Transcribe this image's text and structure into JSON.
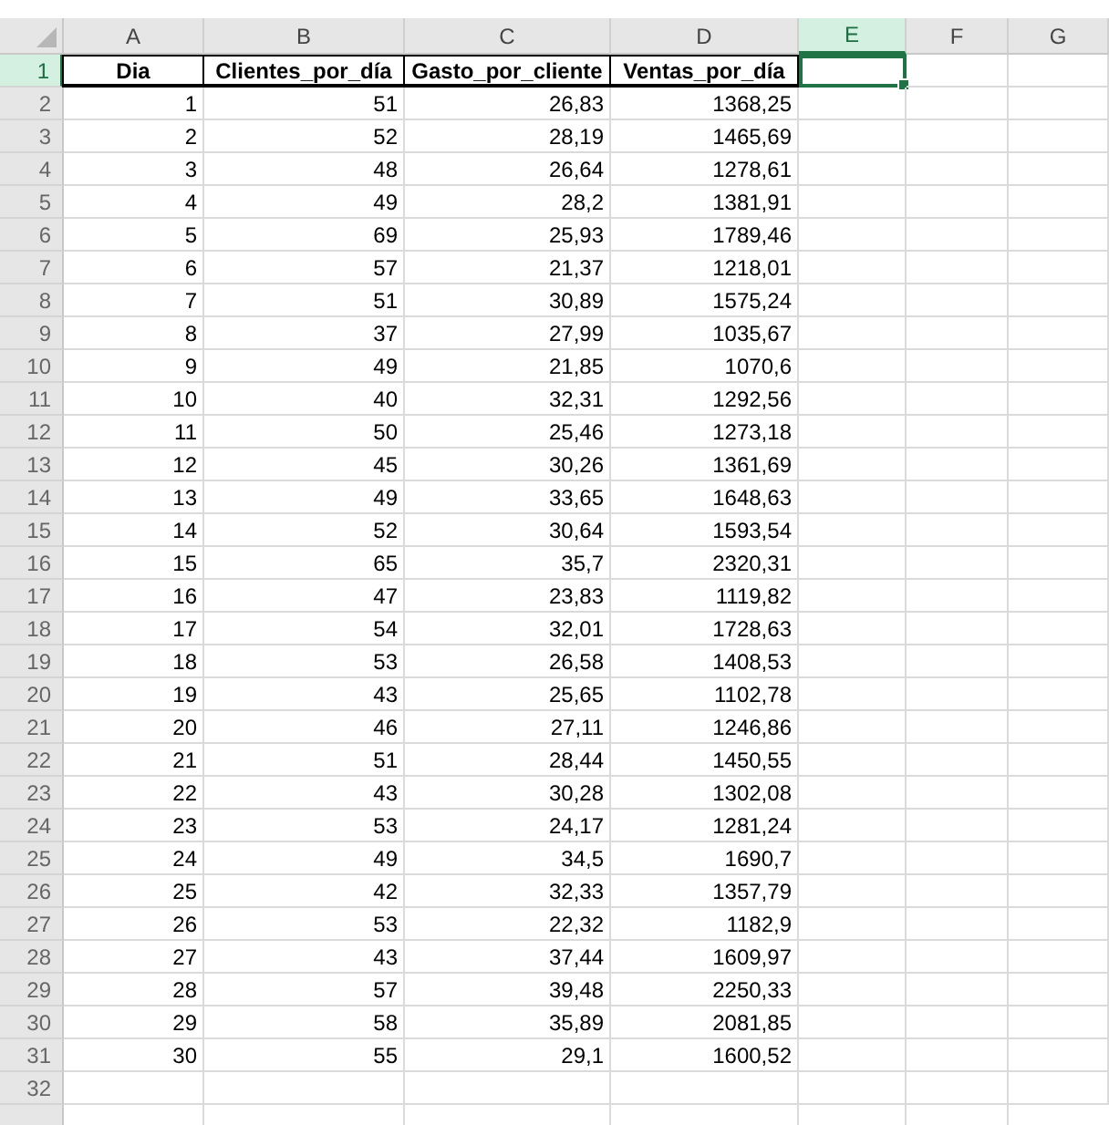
{
  "column_headers": [
    {
      "label": "A",
      "selected": false
    },
    {
      "label": "B",
      "selected": false
    },
    {
      "label": "C",
      "selected": false
    },
    {
      "label": "D",
      "selected": false
    },
    {
      "label": "E",
      "selected": true
    },
    {
      "label": "F",
      "selected": false
    },
    {
      "label": "G",
      "selected": false
    }
  ],
  "rows": [
    {
      "label": "1",
      "selected": true,
      "kind": "header",
      "cells": [
        "Dia",
        "Clientes_por_día",
        "Gasto_por_cliente",
        "Ventas_por_día"
      ]
    },
    {
      "label": "2",
      "selected": false,
      "kind": "data",
      "cells": [
        "1",
        "51",
        "26,83",
        "1368,25"
      ]
    },
    {
      "label": "3",
      "selected": false,
      "kind": "data",
      "cells": [
        "2",
        "52",
        "28,19",
        "1465,69"
      ]
    },
    {
      "label": "4",
      "selected": false,
      "kind": "data",
      "cells": [
        "3",
        "48",
        "26,64",
        "1278,61"
      ]
    },
    {
      "label": "5",
      "selected": false,
      "kind": "data",
      "cells": [
        "4",
        "49",
        "28,2",
        "1381,91"
      ]
    },
    {
      "label": "6",
      "selected": false,
      "kind": "data",
      "cells": [
        "5",
        "69",
        "25,93",
        "1789,46"
      ]
    },
    {
      "label": "7",
      "selected": false,
      "kind": "data",
      "cells": [
        "6",
        "57",
        "21,37",
        "1218,01"
      ]
    },
    {
      "label": "8",
      "selected": false,
      "kind": "data",
      "cells": [
        "7",
        "51",
        "30,89",
        "1575,24"
      ]
    },
    {
      "label": "9",
      "selected": false,
      "kind": "data",
      "cells": [
        "8",
        "37",
        "27,99",
        "1035,67"
      ]
    },
    {
      "label": "10",
      "selected": false,
      "kind": "data",
      "cells": [
        "9",
        "49",
        "21,85",
        "1070,6"
      ]
    },
    {
      "label": "11",
      "selected": false,
      "kind": "data",
      "cells": [
        "10",
        "40",
        "32,31",
        "1292,56"
      ]
    },
    {
      "label": "12",
      "selected": false,
      "kind": "data",
      "cells": [
        "11",
        "50",
        "25,46",
        "1273,18"
      ]
    },
    {
      "label": "13",
      "selected": false,
      "kind": "data",
      "cells": [
        "12",
        "45",
        "30,26",
        "1361,69"
      ]
    },
    {
      "label": "14",
      "selected": false,
      "kind": "data",
      "cells": [
        "13",
        "49",
        "33,65",
        "1648,63"
      ]
    },
    {
      "label": "15",
      "selected": false,
      "kind": "data",
      "cells": [
        "14",
        "52",
        "30,64",
        "1593,54"
      ]
    },
    {
      "label": "16",
      "selected": false,
      "kind": "data",
      "cells": [
        "15",
        "65",
        "35,7",
        "2320,31"
      ]
    },
    {
      "label": "17",
      "selected": false,
      "kind": "data",
      "cells": [
        "16",
        "47",
        "23,83",
        "1119,82"
      ]
    },
    {
      "label": "18",
      "selected": false,
      "kind": "data",
      "cells": [
        "17",
        "54",
        "32,01",
        "1728,63"
      ]
    },
    {
      "label": "19",
      "selected": false,
      "kind": "data",
      "cells": [
        "18",
        "53",
        "26,58",
        "1408,53"
      ]
    },
    {
      "label": "20",
      "selected": false,
      "kind": "data",
      "cells": [
        "19",
        "43",
        "25,65",
        "1102,78"
      ]
    },
    {
      "label": "21",
      "selected": false,
      "kind": "data",
      "cells": [
        "20",
        "46",
        "27,11",
        "1246,86"
      ]
    },
    {
      "label": "22",
      "selected": false,
      "kind": "data",
      "cells": [
        "21",
        "51",
        "28,44",
        "1450,55"
      ]
    },
    {
      "label": "23",
      "selected": false,
      "kind": "data",
      "cells": [
        "22",
        "43",
        "30,28",
        "1302,08"
      ]
    },
    {
      "label": "24",
      "selected": false,
      "kind": "data",
      "cells": [
        "23",
        "53",
        "24,17",
        "1281,24"
      ]
    },
    {
      "label": "25",
      "selected": false,
      "kind": "data",
      "cells": [
        "24",
        "49",
        "34,5",
        "1690,7"
      ]
    },
    {
      "label": "26",
      "selected": false,
      "kind": "data",
      "cells": [
        "25",
        "42",
        "32,33",
        "1357,79"
      ]
    },
    {
      "label": "27",
      "selected": false,
      "kind": "data",
      "cells": [
        "26",
        "53",
        "22,32",
        "1182,9"
      ]
    },
    {
      "label": "28",
      "selected": false,
      "kind": "data",
      "cells": [
        "27",
        "43",
        "37,44",
        "1609,97"
      ]
    },
    {
      "label": "29",
      "selected": false,
      "kind": "data",
      "cells": [
        "28",
        "57",
        "39,48",
        "2250,33"
      ]
    },
    {
      "label": "30",
      "selected": false,
      "kind": "data",
      "cells": [
        "29",
        "58",
        "35,89",
        "2081,85"
      ]
    },
    {
      "label": "31",
      "selected": false,
      "kind": "data",
      "cells": [
        "30",
        "55",
        "29,1",
        "1600,52"
      ]
    },
    {
      "label": "32",
      "selected": false
    }
  ]
}
